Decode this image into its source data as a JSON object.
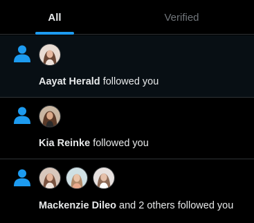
{
  "tabs": [
    {
      "label": "All",
      "active": true
    },
    {
      "label": "Verified",
      "active": false
    }
  ],
  "accent_color": "#1d9bf0",
  "notifications": [
    {
      "icon": "person-icon",
      "user": "Aayat Herald",
      "action": "followed you",
      "avatar_count": 1
    },
    {
      "icon": "person-icon",
      "user": "Kia Reinke",
      "action": "followed you",
      "avatar_count": 1
    },
    {
      "icon": "person-icon",
      "user": "Mackenzie Dileo",
      "action": "and 2 others followed you",
      "avatar_count": 3
    }
  ]
}
